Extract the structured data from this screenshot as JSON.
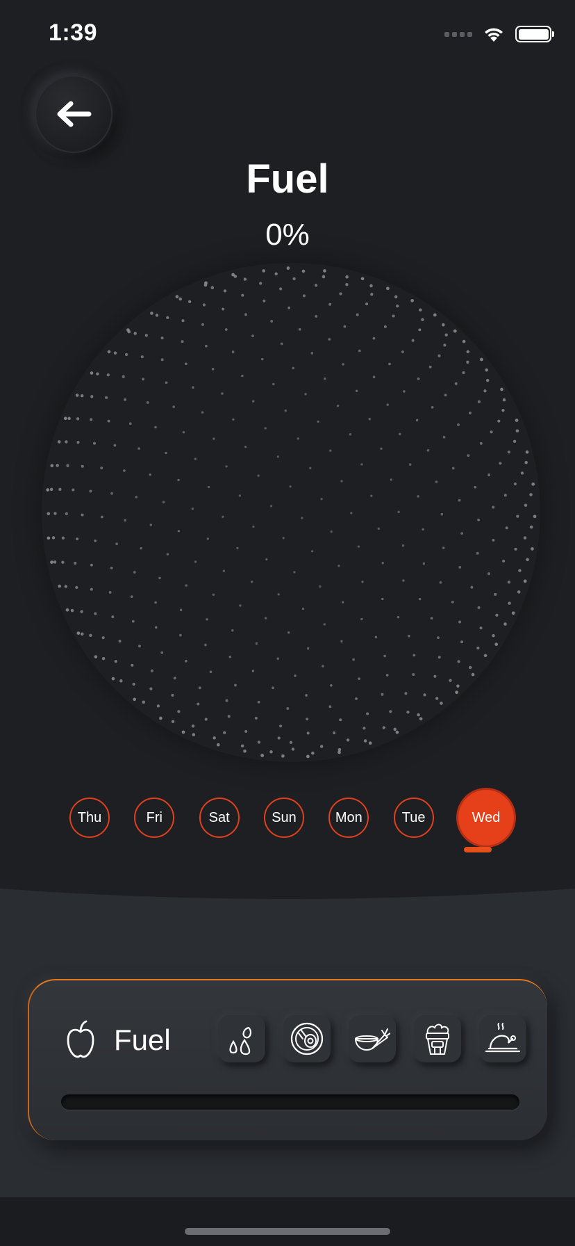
{
  "status_bar": {
    "time": "1:39"
  },
  "header": {
    "title": "Fuel",
    "percent": "0%"
  },
  "progress": {
    "fuel_fraction": 0.0
  },
  "days": [
    "Thu",
    "Fri",
    "Sat",
    "Sun",
    "Mon",
    "Tue",
    "Wed"
  ],
  "active_day": "Wed",
  "card": {
    "label": "Fuel",
    "buttons": [
      "drops-icon",
      "egg-plate-icon",
      "bowl-carrot-icon",
      "popcorn-icon",
      "roast-chicken-icon"
    ]
  },
  "colors": {
    "accent": "#e6401b",
    "background": "#1e1f22",
    "panel": "#2a2d32",
    "card_glow": "#e8781d"
  }
}
